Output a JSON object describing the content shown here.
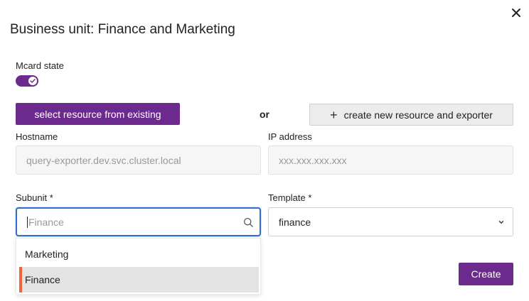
{
  "dialog": {
    "title": "Business unit: Finance and Marketing",
    "close_icon": "close-icon"
  },
  "mcard": {
    "label": "Mcard state",
    "enabled": true,
    "accent": "#6c2a8f"
  },
  "resource": {
    "select_existing_label": "select resource from existing",
    "or_label": "or",
    "create_new_label": "create new resource and exporter",
    "create_new_icon": "plus-icon"
  },
  "hostname": {
    "label": "Hostname",
    "placeholder": "query-exporter.dev.svc.cluster.local"
  },
  "ip_address": {
    "label": "IP address",
    "placeholder": "xxx.xxx.xxx.xxx"
  },
  "subunit": {
    "label": "Subunit *",
    "placeholder": "Finance",
    "value": "",
    "options": [
      {
        "label": "Marketing",
        "selected": false
      },
      {
        "label": "Finance",
        "selected": true
      }
    ]
  },
  "template": {
    "label": "Template *",
    "value": "finance"
  },
  "footer": {
    "create_label": "Create"
  },
  "colors": {
    "primary": "#6c2a8f",
    "focus": "#2e6fcb",
    "selected_indicator": "#f0643a"
  }
}
